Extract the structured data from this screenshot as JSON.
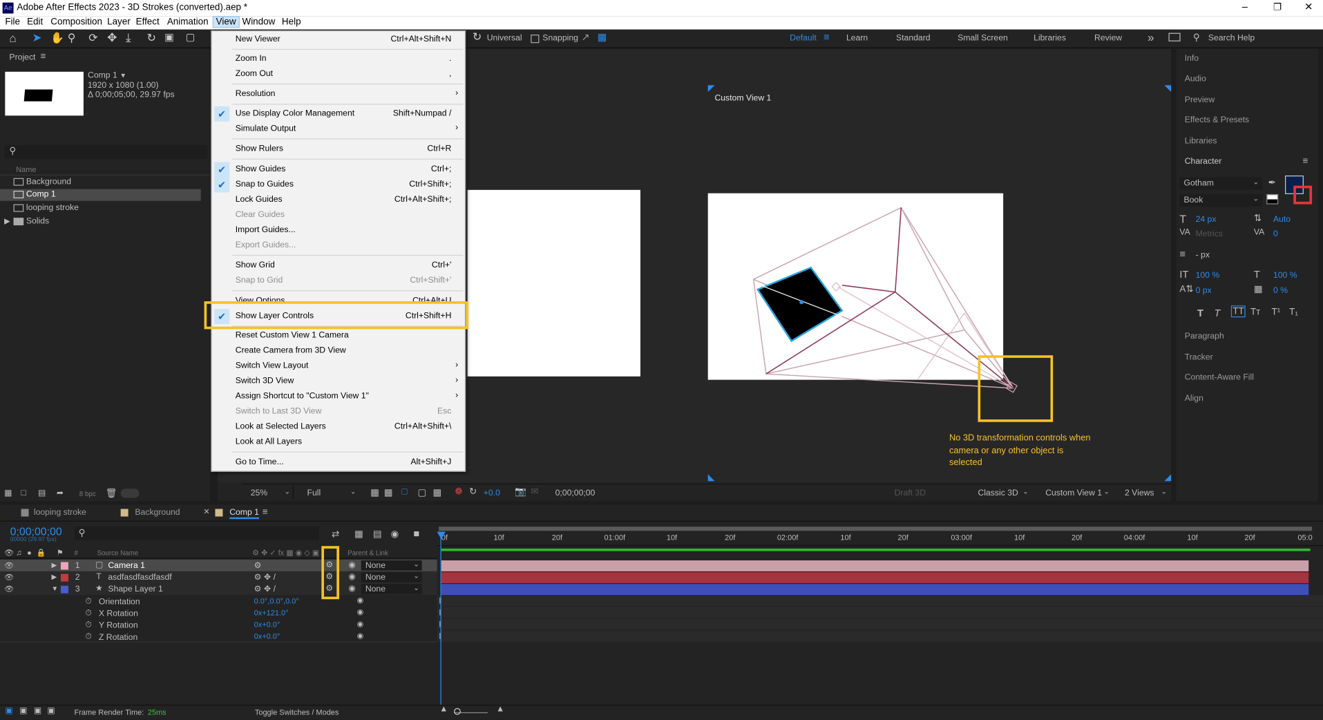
{
  "app": {
    "title": "Adobe After Effects 2023 - 3D Strokes (converted).aep *",
    "icon": "Ae"
  },
  "menubar": [
    "File",
    "Edit",
    "Composition",
    "Layer",
    "Effect",
    "Animation",
    "View",
    "Window",
    "Help"
  ],
  "toolbar": {
    "universal": "Universal",
    "snapping": "Snapping",
    "workspaces": [
      "Default",
      "Learn",
      "Standard",
      "Small Screen",
      "Libraries",
      "Review"
    ],
    "search": "Search Help"
  },
  "project": {
    "title": "Project",
    "comp_name": "Comp 1",
    "comp_info1": "1920 x 1080 (1.00)",
    "comp_info2": "Δ 0;00;05;00, 29.97 fps",
    "col_name": "Name",
    "items": [
      "Background",
      "Comp 1",
      "looping stroke",
      "Solids"
    ],
    "bpc": "8 bpc"
  },
  "view_menu": [
    {
      "label": "New Viewer",
      "shortcut": "Ctrl+Alt+Shift+N"
    },
    {
      "label": "Zoom In",
      "shortcut": "."
    },
    {
      "label": "Zoom Out",
      "shortcut": ","
    },
    {
      "label": "Resolution",
      "shortcut": ""
    },
    {
      "label": "Use Display Color Management",
      "shortcut": "Shift+Numpad /"
    },
    {
      "label": "Simulate Output",
      "shortcut": ""
    },
    {
      "label": "Show Rulers",
      "shortcut": "Ctrl+R"
    },
    {
      "label": "Show Guides",
      "shortcut": "Ctrl+;"
    },
    {
      "label": "Snap to Guides",
      "shortcut": "Ctrl+Shift+;"
    },
    {
      "label": "Lock Guides",
      "shortcut": "Ctrl+Alt+Shift+;"
    },
    {
      "label": "Clear Guides",
      "shortcut": ""
    },
    {
      "label": "Import Guides...",
      "shortcut": ""
    },
    {
      "label": "Export Guides...",
      "shortcut": ""
    },
    {
      "label": "Show Grid",
      "shortcut": "Ctrl+'"
    },
    {
      "label": "Snap to Grid",
      "shortcut": "Ctrl+Shift+'"
    },
    {
      "label": "View Options...",
      "shortcut": "Ctrl+Alt+U"
    },
    {
      "label": "Show Layer Controls",
      "shortcut": "Ctrl+Shift+H"
    },
    {
      "label": "Reset Custom View 1 Camera",
      "shortcut": ""
    },
    {
      "label": "Create Camera from 3D View",
      "shortcut": ""
    },
    {
      "label": "Switch View Layout",
      "shortcut": ""
    },
    {
      "label": "Switch 3D View",
      "shortcut": ""
    },
    {
      "label": "Assign Shortcut to \"Custom View 1\"",
      "shortcut": ""
    },
    {
      "label": "Switch to Last 3D View",
      "shortcut": "Esc"
    },
    {
      "label": "Look at Selected Layers",
      "shortcut": "Ctrl+Alt+Shift+\\"
    },
    {
      "label": "Look at All Layers",
      "shortcut": ""
    },
    {
      "label": "Go to Time...",
      "shortcut": "Alt+Shift+J"
    }
  ],
  "viewer": {
    "view_label": "Custom View 1",
    "annotation": "No 3D transformation controls when camera or any other object is selected",
    "zoom": "25%",
    "resolution": "Full",
    "timecode": "0;00;00;00",
    "exposure": "+0.0",
    "renderer": "Classic 3D",
    "view": "Custom View 1",
    "views": "2 Views",
    "draft": "Draft 3D"
  },
  "right_panels": [
    "Info",
    "Audio",
    "Preview",
    "Effects & Presets",
    "Libraries",
    "Character",
    "Paragraph",
    "Tracker",
    "Content-Aware Fill",
    "Align"
  ],
  "character": {
    "font": "Gotham",
    "style": "Book",
    "size": "24 px",
    "leading": "Auto",
    "kerning": "Metrics",
    "tracking": "0",
    "stroke": "- px",
    "vscale": "100 %",
    "hscale": "100 %",
    "baseline": "0 px",
    "tsume": "0 %"
  },
  "timeline": {
    "tabs": [
      "looping stroke",
      "Background",
      "Comp 1"
    ],
    "timecode": "0;00;00;00",
    "fps": "00000 (29.97 fps)",
    "col_source": "Source Name",
    "col_parent": "Parent & Link",
    "layers": [
      {
        "num": "1",
        "name": "Camera 1",
        "parent": "None",
        "color": "#e8a6b8"
      },
      {
        "num": "2",
        "name": "asdfasdfasdfasdf",
        "parent": "None",
        "color": "#c33b3b"
      },
      {
        "num": "3",
        "name": "Shape Layer 1",
        "parent": "None",
        "color": "#4a5bd6"
      }
    ],
    "props": [
      {
        "name": "Orientation",
        "value": "0.0°,0.0°,0.0°"
      },
      {
        "name": "X Rotation",
        "value": "0x+121.0°"
      },
      {
        "name": "Y Rotation",
        "value": "0x+0.0°"
      },
      {
        "name": "Z Rotation",
        "value": "0x+0.0°"
      }
    ],
    "ruler": [
      "0f",
      "10f",
      "20f",
      "01:00f",
      "10f",
      "20f",
      "02:00f",
      "10f",
      "20f",
      "03:00f",
      "10f",
      "20f",
      "04:00f",
      "10f",
      "20f",
      "05:0"
    ],
    "render_time_label": "Frame Render Time:",
    "render_time": "25ms",
    "toggle": "Toggle Switches / Modes"
  }
}
